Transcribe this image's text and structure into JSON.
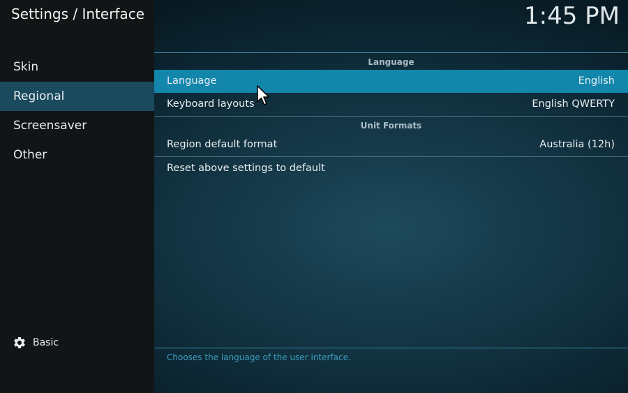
{
  "header": {
    "title": "Settings / Interface",
    "clock": "1:45 PM"
  },
  "sidebar": {
    "items": [
      {
        "label": "Skin"
      },
      {
        "label": "Regional"
      },
      {
        "label": "Screensaver"
      },
      {
        "label": "Other"
      }
    ],
    "active_index": 1,
    "level": {
      "label": "Basic",
      "icon": "gear-icon"
    }
  },
  "content": {
    "sections": [
      {
        "header": "Language",
        "items": [
          {
            "label": "Language",
            "value": "English"
          },
          {
            "label": "Keyboard layouts",
            "value": "English QWERTY"
          }
        ]
      },
      {
        "header": "Unit Formats",
        "items": [
          {
            "label": "Region default format",
            "value": "Australia (12h)"
          },
          {
            "label": "Reset above settings to default",
            "value": ""
          }
        ]
      }
    ],
    "selected_item": "Language"
  },
  "footer": {
    "description": "Chooses the language of the user interface."
  },
  "colors": {
    "accent": "#1286ab",
    "sidebar_bg": "#121516",
    "sidebar_active": "#1a4a5e",
    "description_text": "#3f9dbf"
  }
}
